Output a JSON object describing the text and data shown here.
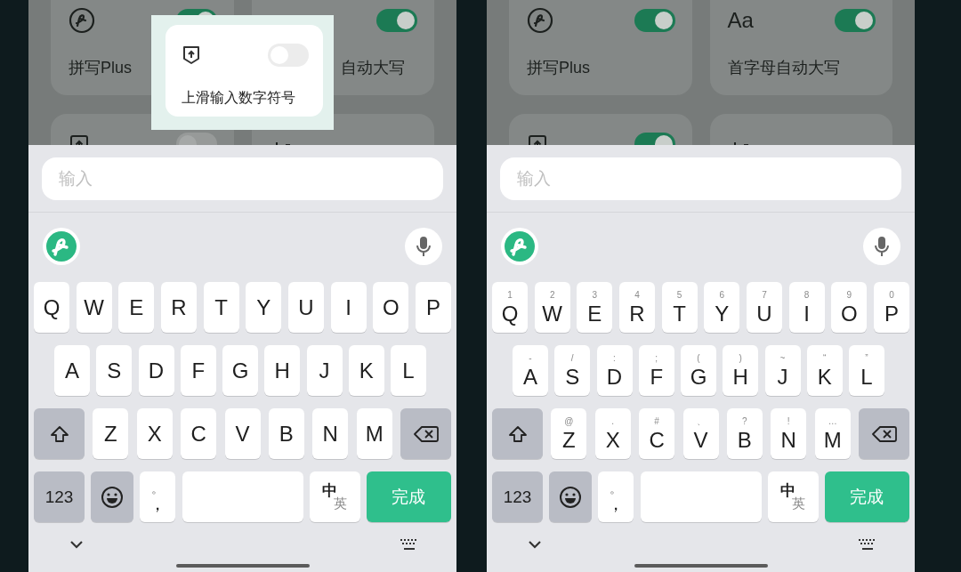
{
  "screens": [
    {
      "cards": [
        {
          "kind": "logo",
          "label": "拼写Plus",
          "on": true
        },
        {
          "kind": "plain",
          "label": "自动大写",
          "on": true
        },
        {
          "kind": "upload",
          "on": false
        },
        {
          "kind": "hook"
        }
      ],
      "popup": {
        "label": "上滑输入数字符号",
        "on": false
      },
      "input": {
        "placeholder": "输入"
      },
      "rows": [
        [
          {
            "label": "Q"
          },
          {
            "label": "W"
          },
          {
            "label": "E"
          },
          {
            "label": "R"
          },
          {
            "label": "T"
          },
          {
            "label": "Y"
          },
          {
            "label": "U"
          },
          {
            "label": "I"
          },
          {
            "label": "O"
          },
          {
            "label": "P"
          }
        ],
        [
          {
            "label": "A"
          },
          {
            "label": "S"
          },
          {
            "label": "D"
          },
          {
            "label": "F"
          },
          {
            "label": "G"
          },
          {
            "label": "H"
          },
          {
            "label": "J"
          },
          {
            "label": "K"
          },
          {
            "label": "L"
          }
        ],
        [
          {
            "kind": "shift"
          },
          {
            "label": "Z"
          },
          {
            "label": "X"
          },
          {
            "label": "C"
          },
          {
            "label": "V"
          },
          {
            "label": "B"
          },
          {
            "label": "N"
          },
          {
            "label": "M"
          },
          {
            "kind": "backspace"
          }
        ]
      ],
      "function_row": [
        {
          "kind": "numbers",
          "label": "123"
        },
        {
          "kind": "emoji"
        },
        {
          "kind": "punct",
          "top": "。",
          "bottom": "，"
        },
        {
          "kind": "space"
        },
        {
          "kind": "lang",
          "primary": "中",
          "secondary": "英"
        },
        {
          "kind": "done",
          "label": "完成"
        }
      ]
    },
    {
      "cards": [
        {
          "kind": "logo",
          "label": "拼写Plus",
          "on": true
        },
        {
          "kind": "glyph",
          "glyph": "Aa",
          "label": "首字母自动大写",
          "on": true
        },
        {
          "kind": "upload",
          "on": true
        },
        {
          "kind": "hook"
        }
      ],
      "input": {
        "placeholder": "输入"
      },
      "rows": [
        [
          {
            "label": "Q",
            "hint": "1"
          },
          {
            "label": "W",
            "hint": "2"
          },
          {
            "label": "E",
            "hint": "3"
          },
          {
            "label": "R",
            "hint": "4"
          },
          {
            "label": "T",
            "hint": "5"
          },
          {
            "label": "Y",
            "hint": "6"
          },
          {
            "label": "U",
            "hint": "7"
          },
          {
            "label": "I",
            "hint": "8"
          },
          {
            "label": "O",
            "hint": "9"
          },
          {
            "label": "P",
            "hint": "0"
          }
        ],
        [
          {
            "label": "A",
            "hint": "-"
          },
          {
            "label": "S",
            "hint": "/"
          },
          {
            "label": "D",
            "hint": ":"
          },
          {
            "label": "F",
            "hint": ";"
          },
          {
            "label": "G",
            "hint": "("
          },
          {
            "label": "H",
            "hint": ")"
          },
          {
            "label": "J",
            "hint": "~"
          },
          {
            "label": "K",
            "hint": "“"
          },
          {
            "label": "L",
            "hint": "”"
          }
        ],
        [
          {
            "kind": "shift"
          },
          {
            "label": "Z",
            "hint": "@"
          },
          {
            "label": "X",
            "hint": "."
          },
          {
            "label": "C",
            "hint": "#"
          },
          {
            "label": "V",
            "hint": "、"
          },
          {
            "label": "B",
            "hint": "?"
          },
          {
            "label": "N",
            "hint": "!"
          },
          {
            "label": "M",
            "hint": "…"
          },
          {
            "kind": "backspace"
          }
        ]
      ],
      "function_row": [
        {
          "kind": "numbers",
          "label": "123"
        },
        {
          "kind": "emoji"
        },
        {
          "kind": "punct",
          "top": "。",
          "bottom": "，"
        },
        {
          "kind": "space"
        },
        {
          "kind": "lang",
          "primary": "中",
          "secondary": "英"
        },
        {
          "kind": "done",
          "label": "完成"
        }
      ]
    }
  ]
}
